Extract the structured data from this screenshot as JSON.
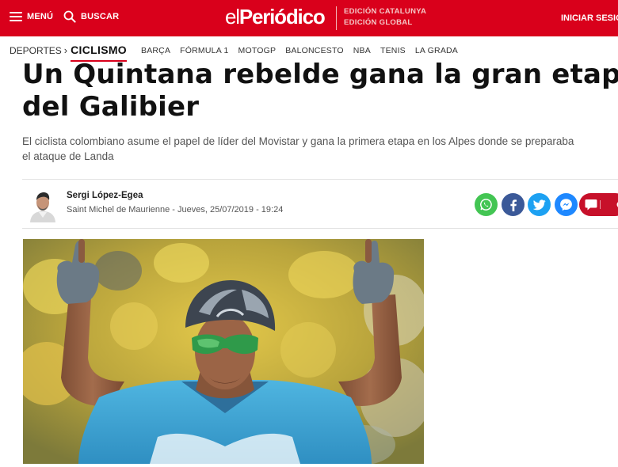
{
  "header": {
    "menu_label": "MENÚ",
    "search_label": "BUSCAR",
    "logo_el": "el",
    "logo_name": "Periódico",
    "editions": [
      "EDICIÓN CATALUNYA",
      "EDICIÓN GLOBAL"
    ],
    "login_label": "INICIAR SESIÓN"
  },
  "nav": {
    "section": "DEPORTES",
    "current": "CICLISMO",
    "items": [
      "BARÇA",
      "FÓRMULA 1",
      "MOTOGP",
      "BALONCESTO",
      "NBA",
      "TENIS",
      "LA GRADA"
    ]
  },
  "article": {
    "title_line1": "Un Quintana rebelde gana la gran etapa",
    "title_line2": "del Galibier",
    "subtitle_line1": "El ciclista colombiano asume el papel de líder del Movistar y gana la primera etapa en los Alpes donde se preparaba",
    "subtitle_line2": "el ataque de Landa",
    "author": "Sergi López-Egea",
    "meta": "Saint Michel de Maurienne - Jueves, 25/07/2019 - 19:24"
  },
  "share": {
    "icons": [
      "whatsapp-icon",
      "facebook-icon",
      "twitter-icon",
      "messenger-icon",
      "comments-icon"
    ],
    "colors": {
      "whatsapp": "#43c553",
      "facebook": "#3b5998",
      "twitter": "#1da1f2",
      "messenger": "#1e88ff",
      "comments": "#c7102a"
    }
  },
  "colors": {
    "brand_red": "#d9001b",
    "edition_text": "#f4c6c6"
  }
}
